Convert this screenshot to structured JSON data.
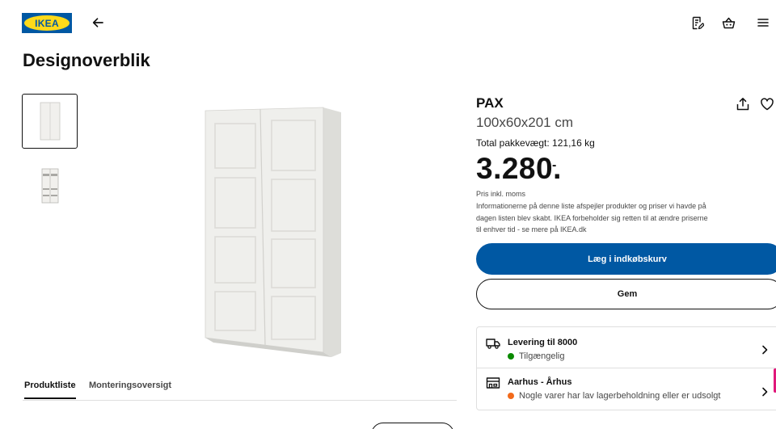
{
  "header": {
    "logo_text": "IKEA",
    "icons": [
      "arrow-left-icon",
      "shopping-list-icon",
      "shopping-basket-icon",
      "hamburger-menu-icon"
    ]
  },
  "page": {
    "title": "Designoverblik"
  },
  "tabs": [
    {
      "label": "Produktliste",
      "active": true
    },
    {
      "label": "Monteringsoversigt",
      "active": false
    }
  ],
  "product": {
    "name": "PAX",
    "dimensions": "100x60x201 cm",
    "weight": "Total pakkevægt: 121,16 kg",
    "price": "3.280.",
    "price_suffix": "-",
    "vat_note": "Pris inkl. moms",
    "info_text": "Informationerne på denne liste afspejler produkter og priser vi havde på dagen listen blev skabt. IKEA forbeholder sig retten til at ændre priserne til enhver tid - se mere på IKEA.dk"
  },
  "actions": {
    "add_to_cart": "Læg i indkøbskurv",
    "save": "Gem"
  },
  "availability": {
    "delivery": {
      "title": "Levering til 8000",
      "status": "Tilgængelig",
      "status_color": "#0a8a00"
    },
    "store": {
      "title": "Aarhus - Århus",
      "status": "Nogle varer har lav lagerbeholdning eller er udsolgt",
      "status_color": "#f26a1b"
    }
  },
  "colors": {
    "brand_blue": "#0058a3",
    "brand_yellow": "#ffda1a"
  }
}
